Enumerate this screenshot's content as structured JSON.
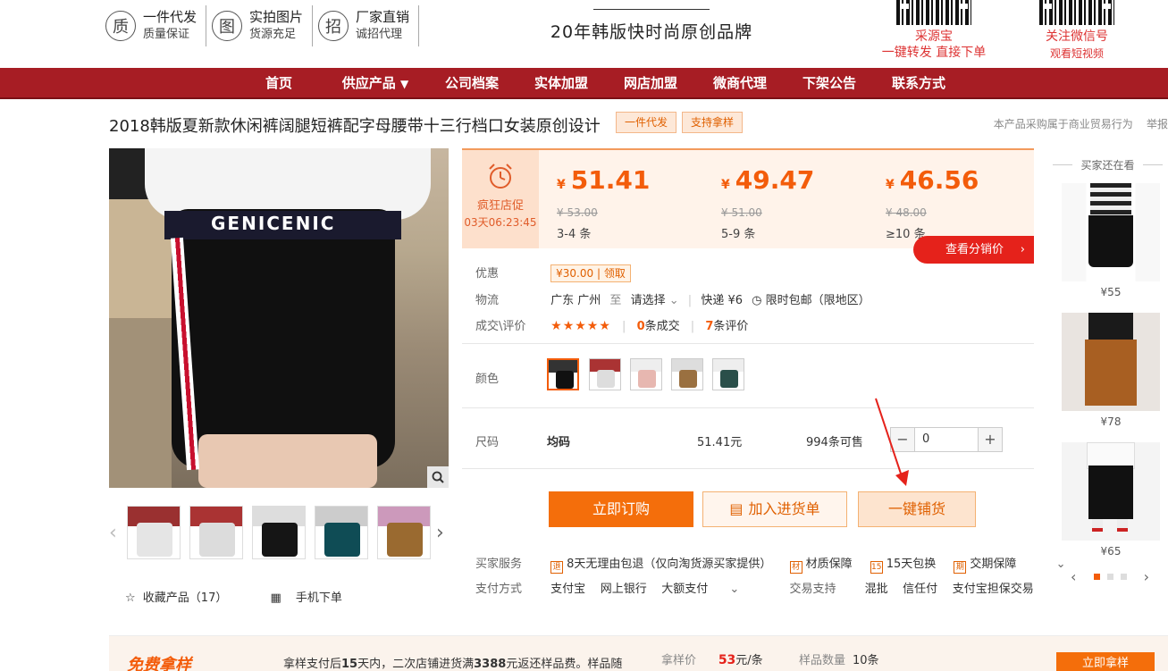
{
  "header": {
    "badges": [
      {
        "glyph": "质",
        "title": "一件代发",
        "sub": "质量保证"
      },
      {
        "glyph": "图",
        "title": "实拍图片",
        "sub": "货源充足"
      },
      {
        "glyph": "招",
        "title": "厂家直销",
        "sub": "诚招代理"
      }
    ],
    "slogan": "20年韩版快时尚原创品牌",
    "qr_left": {
      "line1": "采源宝",
      "line2": "一键转发 直接下单"
    },
    "qr_right": {
      "line1": "关注微信号",
      "line2": "观看短视频"
    }
  },
  "nav": {
    "items": [
      "首页",
      "供应产品",
      "公司档案",
      "实体加盟",
      "网店加盟",
      "微商代理",
      "下架公告",
      "联系方式"
    ],
    "dropdown_glyph": "▼"
  },
  "product": {
    "title": "2018韩版夏新款休闲裤阔腿短裤配字母腰带十三行档口女装原创设计",
    "tags": [
      "一件代发",
      "支持拿样"
    ],
    "notice": "本产品采购属于商业贸易行为",
    "report": "举报",
    "belt_text": "GENICENIC"
  },
  "promo": {
    "label": "疯狂店促",
    "countdown": "03天06:23:45"
  },
  "prices": [
    {
      "currency": "¥",
      "value": "51.41",
      "old": "¥ 53.00",
      "qty": "3-4 条"
    },
    {
      "currency": "¥",
      "value": "49.47",
      "old": "¥ 51.00",
      "qty": "5-9 条"
    },
    {
      "currency": "¥",
      "value": "46.56",
      "old": "¥ 48.00",
      "qty": "≥10 条"
    }
  ],
  "distribution_button": "查看分销价",
  "distribution_arrow": "›",
  "info": {
    "discount_label": "优惠",
    "coupon": "¥30.00",
    "coupon_action": "领取",
    "logistics_label": "物流",
    "origin": "广东 广州",
    "to": "至",
    "destination": "请选择",
    "shipping": "快递 ¥6",
    "free_ship": "限时包邮（限地区）",
    "deal_label": "成交\\评价",
    "stars": "★★★★★",
    "deals_count": "0",
    "deals_suffix": "条成交",
    "reviews_count": "7",
    "reviews_suffix": "条评价"
  },
  "color_label": "颜色",
  "size": {
    "label": "尺码",
    "value": "均码",
    "price": "51.41元",
    "stock": "994条可售",
    "qty": "0",
    "minus": "−",
    "plus": "+"
  },
  "buttons": {
    "buy": "立即订购",
    "cart": "加入进货单",
    "push": "一键铺货"
  },
  "services": {
    "buyer_label": "买家服务",
    "items": [
      {
        "icon": "退",
        "text": "8天无理由包退（仅向淘货源买家提供）"
      },
      {
        "icon": "材",
        "text": "材质保障"
      },
      {
        "icon": "15",
        "text": "15天包换"
      },
      {
        "icon": "期",
        "text": "交期保障"
      }
    ],
    "pay_label": "支付方式",
    "pay": [
      "支付宝",
      "网上银行",
      "大额支付"
    ],
    "trade_label": "交易支持",
    "trade": [
      "混批",
      "信任付",
      "支付宝担保交易"
    ]
  },
  "favorite": {
    "label": "收藏产品（17）",
    "mobile": "手机下单"
  },
  "recommend": {
    "title": "买家还在看",
    "items": [
      {
        "price": "¥55"
      },
      {
        "price": "¥78"
      },
      {
        "price": "¥65"
      }
    ]
  },
  "bottom": {
    "title": "免费拿样",
    "desc_a": "拿样支付后",
    "desc_b": "15",
    "desc_c": "天内，二次店铺进货满",
    "desc_d": "3388",
    "desc_e": "元返还样品费。样品随",
    "sample_price_label": "拿样价",
    "sample_price": "53",
    "sample_price_unit": "元/条",
    "sample_qty_label": "样品数量",
    "sample_qty": "10条",
    "get_button": "立即拿样"
  },
  "colors": {
    "accent": "#f35c0a",
    "nav": "#a71d24",
    "red": "#e5221b"
  }
}
